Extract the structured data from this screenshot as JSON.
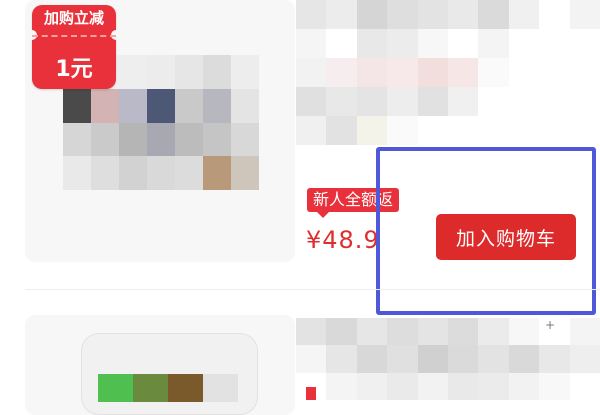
{
  "product1": {
    "badge": {
      "top_text": "加购立减",
      "bottom_text": "1元"
    },
    "promo_tag": "新人全额返",
    "price": "¥48.9",
    "add_to_cart_label": "加入购物车"
  },
  "colors": {
    "accent_red": "#e8313b",
    "highlight_blue": "#4f58d8",
    "price_red": "#e02e2e"
  }
}
